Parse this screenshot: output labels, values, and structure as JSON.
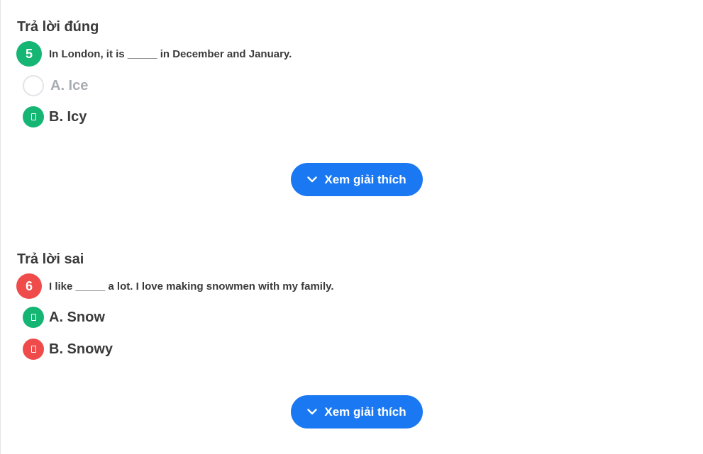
{
  "questions": [
    {
      "status": "Trả lời đúng",
      "number": "5",
      "result": "correct",
      "text": "In London, it is _____ in December and January.",
      "options": [
        {
          "label": "A. Ice",
          "state": "unselected"
        },
        {
          "label": "B. Icy",
          "state": "correct"
        }
      ],
      "button_label": "Xem giải thích"
    },
    {
      "status": "Trả lời sai",
      "number": "6",
      "result": "wrong",
      "text": "I like _____ a lot. I love making snowmen with my family.",
      "options": [
        {
          "label": "A. Snow",
          "state": "correct"
        },
        {
          "label": "B. Snowy",
          "state": "wrong"
        }
      ],
      "button_label": "Xem giải thích"
    }
  ],
  "colors": {
    "correct": "#15b573",
    "wrong": "#ef4b4b",
    "button": "#1a78f2",
    "muted_text": "#a8acb3"
  }
}
